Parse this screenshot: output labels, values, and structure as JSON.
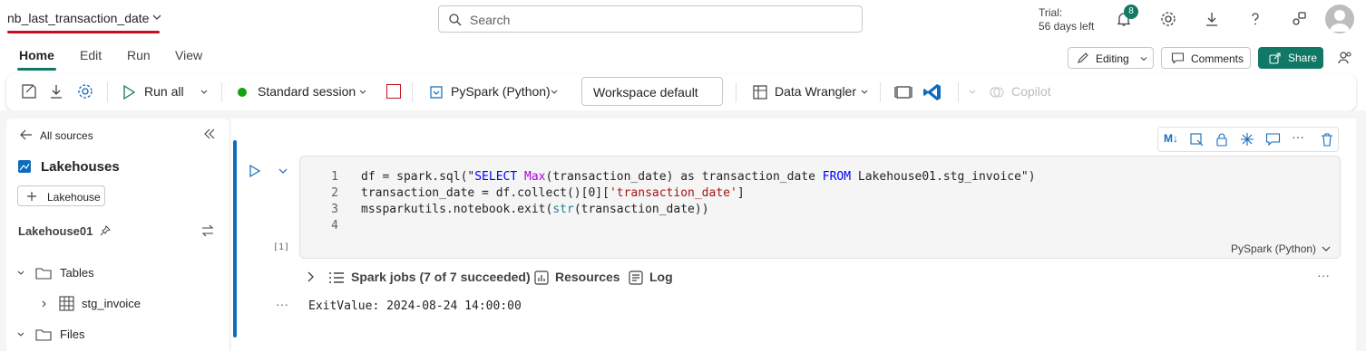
{
  "header": {
    "notebook_title": "nb_last_transaction_date",
    "search_placeholder": "Search",
    "trial_line1": "Trial:",
    "trial_line2": "56 days left",
    "notification_count": "8"
  },
  "tabs": [
    {
      "label": "Home",
      "active": true
    },
    {
      "label": "Edit"
    },
    {
      "label": "Run"
    },
    {
      "label": "View"
    }
  ],
  "tab_actions": {
    "editing_label": "Editing",
    "comments_label": "Comments",
    "share_label": "Share"
  },
  "ribbon": {
    "run_all_label": "Run all",
    "session_label": "Standard session",
    "language_label": "PySpark (Python)",
    "workspace_label": "Workspace default",
    "data_wrangler_label": "Data Wrangler",
    "copilot_label": "Copilot"
  },
  "sidebar": {
    "back_label": "All sources",
    "section_title": "Lakehouses",
    "add_button_label": "Lakehouse",
    "lakehouse_name": "Lakehouse01",
    "tree": [
      {
        "label": "Tables",
        "level": 0
      },
      {
        "label": "stg_invoice",
        "level": 1
      },
      {
        "label": "Files",
        "level": 0
      }
    ]
  },
  "cell": {
    "line_numbers": [
      "1",
      "2",
      "3",
      "4"
    ],
    "code": {
      "l1_a": "df = spark.sql(\"",
      "l1_kw1": "SELECT",
      "l1_sp1": " ",
      "l1_fn": "Max",
      "l1_b": "(transaction_date) as transaction_date ",
      "l1_kw2": "FROM",
      "l1_c": " Lakehouse01.stg_invoice\")",
      "l2_a": "transaction_date = df.collect()[0][",
      "l2_str": "'transaction_date'",
      "l2_b": "]",
      "l3_a": "mssparkutils.notebook.exit(",
      "l3_bi": "str",
      "l3_b": "(transaction_date))"
    },
    "execution_count": "[1]",
    "language": "PySpark (Python)",
    "spark_jobs_label": "Spark jobs (7 of 7 succeeded)",
    "resources_label": "Resources",
    "log_label": "Log",
    "output": "ExitValue: 2024-08-24 14:00:00"
  },
  "colors": {
    "accent": "#117865",
    "cell_accent": "#0f6cbd",
    "title_underline": "#c50f1f"
  }
}
